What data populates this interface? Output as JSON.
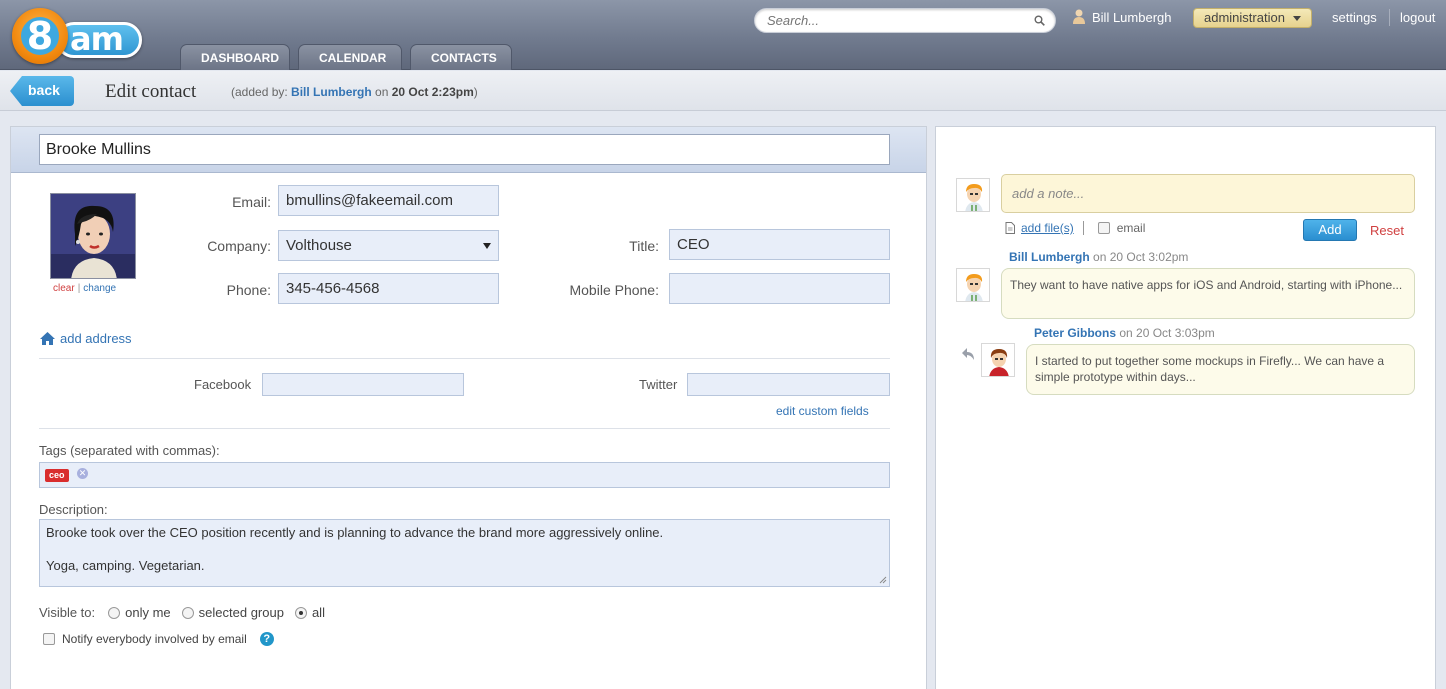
{
  "header": {
    "logo_text_left": "8",
    "logo_text_right": "am",
    "tabs": [
      {
        "label": "DASHBOARD"
      },
      {
        "label": "CALENDAR"
      },
      {
        "label": "CONTACTS"
      }
    ],
    "search_placeholder": "Search...",
    "user_name": "Bill Lumbergh",
    "admin_label": "administration",
    "settings_label": "settings",
    "logout_label": "logout"
  },
  "subheader": {
    "back_label": "back",
    "title": "Edit contact",
    "added_prefix": "(added by: ",
    "added_by": "Bill Lumbergh",
    "added_on": " on ",
    "added_date": "20 Oct 2:23pm",
    "added_suffix": ")"
  },
  "contact": {
    "name": "Brooke Mullins",
    "clear_label": "clear",
    "change_label": "change",
    "email_label": "Email:",
    "email": "bmullins@fakeemail.com",
    "company_label": "Company:",
    "company": "Volthouse",
    "title_label": "Title:",
    "title": "CEO",
    "phone_label": "Phone:",
    "phone": "345-456-4568",
    "mobile_label": "Mobile Phone:",
    "mobile": "",
    "add_address": "add address",
    "facebook_label": "Facebook",
    "facebook": "",
    "twitter_label": "Twitter",
    "twitter": "",
    "edit_custom_fields": "edit custom fields",
    "tags_label": "Tags (separated with commas):",
    "tags": [
      "ceo"
    ],
    "description_label": "Description:",
    "description_lines": [
      "Brooke took over the CEO position recently and is planning to advance the brand more aggressively online.",
      "Yoga, camping. Vegetarian."
    ],
    "visible_label": "Visible to:",
    "visible_options": [
      "only me",
      "selected group",
      "all"
    ],
    "visible_selected": "all",
    "notify_label": "Notify everybody involved by email",
    "help_symbol": "?"
  },
  "notes": {
    "placeholder": "add a note...",
    "add_files": "add file(s)",
    "email_label": "email",
    "add_button": "Add",
    "reset_button": "Reset",
    "items": [
      {
        "author": "Bill Lumbergh",
        "when": "on 20 Oct 3:02pm",
        "text": "They want to have native apps for iOS and Android, starting with iPhone..."
      },
      {
        "author": "Peter Gibbons",
        "when": "on 20 Oct 3:03pm",
        "text": "I started to put together some mockups in Firefly... We can have a simple prototype within days..."
      }
    ]
  },
  "colors": {
    "accent_blue": "#3474b4",
    "button_blue": "#2a8ed0",
    "tag_red": "#d92d2d",
    "field_bg": "#e8eef9",
    "note_bg": "#fdf6d8"
  }
}
